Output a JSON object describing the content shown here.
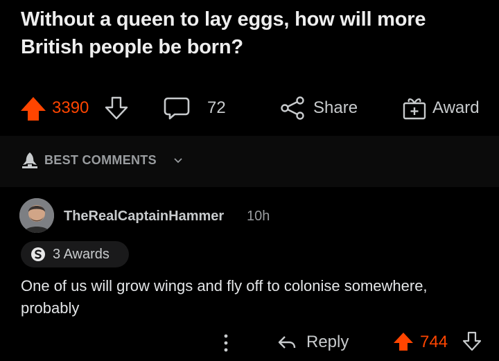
{
  "post": {
    "title": "Without a queen to lay eggs, how will more British people be born?"
  },
  "actions": {
    "score": "3390",
    "comment_count": "72",
    "share_label": "Share",
    "award_label": "Award"
  },
  "sort": {
    "label": "BEST COMMENTS"
  },
  "comment": {
    "username": "TheRealCaptainHammer",
    "timestamp": "10h",
    "awards_label": "3 Awards",
    "body": "One of us will grow wings and fly off to colonise somewhere, probably",
    "reply_label": "Reply",
    "score": "744"
  },
  "colors": {
    "upvote": "#ff4500",
    "background": "#000000",
    "text": "#d7dadc",
    "muted": "#9a9da0"
  },
  "icons": {
    "upvote": "arrow-up-icon",
    "downvote": "arrow-down-icon",
    "comment": "comment-bubble-icon",
    "share": "share-icon",
    "award": "gift-icon",
    "sort": "rocket-icon",
    "more": "vertical-dots-icon",
    "reply": "reply-arrow-icon"
  }
}
